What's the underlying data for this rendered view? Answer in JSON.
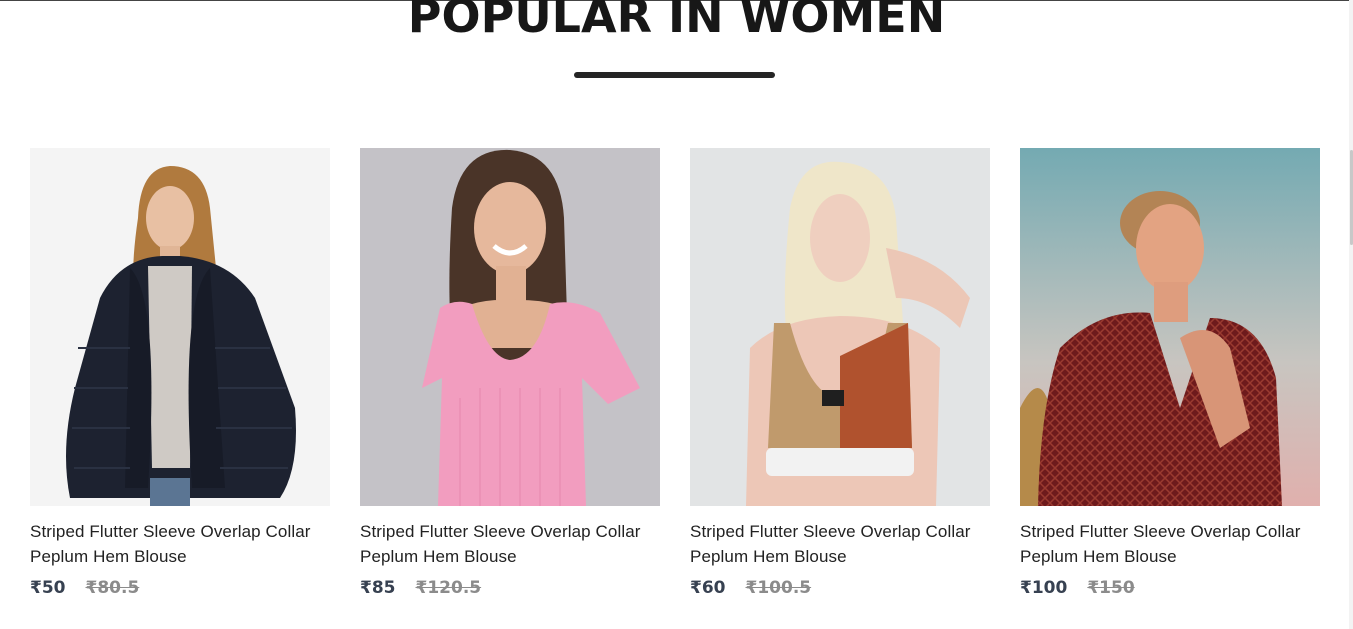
{
  "section": {
    "title": "POPULAR IN WOMEN"
  },
  "products": [
    {
      "name": "Striped Flutter Sleeve Overlap Collar Peplum Hem Blouse",
      "new_price": "₹50",
      "old_price": "₹80.5",
      "image": "woman-black-fur-jacket"
    },
    {
      "name": "Striped Flutter Sleeve Overlap Collar Peplum Hem Blouse",
      "new_price": "₹85",
      "old_price": "₹120.5",
      "image": "woman-pink-top"
    },
    {
      "name": "Striped Flutter Sleeve Overlap Collar Peplum Hem Blouse",
      "new_price": "₹60",
      "old_price": "₹100.5",
      "image": "woman-sports-crop-top"
    },
    {
      "name": "Striped Flutter Sleeve Overlap Collar Peplum Hem Blouse",
      "new_price": "₹100",
      "old_price": "₹150",
      "image": "woman-red-patterned-blouse"
    }
  ],
  "colors": {
    "title": "#171717",
    "underline": "#252525",
    "new_price": "#374151",
    "old_price": "#8b8b8b"
  }
}
